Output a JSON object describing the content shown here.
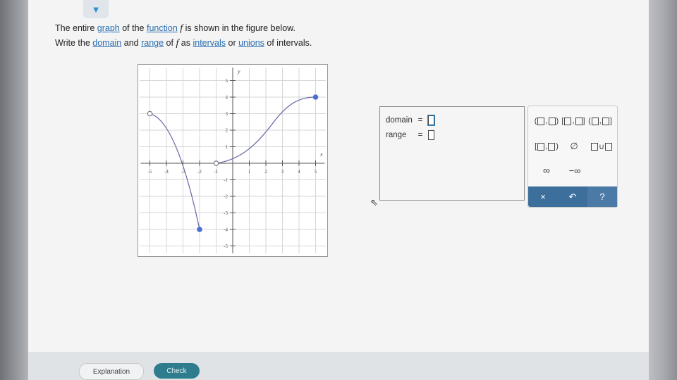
{
  "question": {
    "line1_pre": "The entire ",
    "line1_link1": "graph",
    "line1_mid1": " of the ",
    "line1_link2": "function",
    "line1_fn": "f",
    "line1_post": " is shown in the figure below.",
    "line2_pre": "Write the ",
    "line2_link1": "domain",
    "line2_mid1": " and ",
    "line2_link2": "range",
    "line2_mid2": " of ",
    "line2_fn": "f",
    "line2_mid3": " as ",
    "line2_link3": "intervals",
    "line2_mid4": " or ",
    "line2_link4": "unions",
    "line2_post": " of intervals."
  },
  "graph": {
    "x_axis_label": "x",
    "y_axis_label": "y",
    "x_ticks": [
      "-5",
      "-4",
      "-3",
      "-2",
      "-1",
      "1",
      "2",
      "3",
      "4",
      "5"
    ],
    "y_ticks": [
      "5",
      "4",
      "3",
      "2",
      "1",
      "-1",
      "-2",
      "-3",
      "-4",
      "-5"
    ],
    "segments": [
      {
        "from": [
          -5,
          3
        ],
        "to": [
          -2,
          -4
        ],
        "start": "open",
        "end": "closed"
      },
      {
        "from": [
          -1,
          0
        ],
        "to": [
          5,
          4
        ],
        "start": "open",
        "end": "closed"
      }
    ],
    "curve_color": "#6b6fa8",
    "point_color": "#4a6fcf"
  },
  "answer": {
    "domain_label": "domain",
    "range_label": "range",
    "equals": "="
  },
  "keypad": {
    "infinity": "∞",
    "neg_infinity": "−∞",
    "empty_set": "∅",
    "union": "∪",
    "clear": "×",
    "undo": "↶",
    "help": "?"
  },
  "footer": {
    "explanation_label": "Explanation",
    "check_label": "Check"
  },
  "colors": {
    "accent": "#2b8fd1",
    "check_button": "#2e7d8e",
    "keypad_bar": "#3d6f9c"
  }
}
